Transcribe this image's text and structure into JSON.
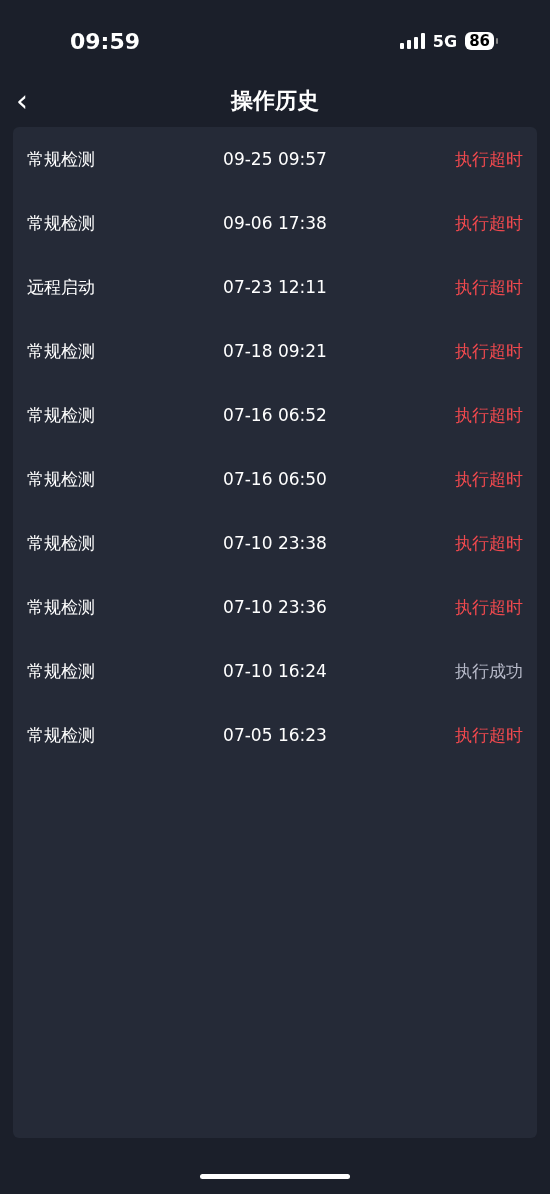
{
  "status_bar": {
    "time": "09:59",
    "network": "5G",
    "battery": "86"
  },
  "nav": {
    "back": "‹",
    "title": "操作历史"
  },
  "rows": [
    {
      "operation": "常规检测",
      "time": "09-25 09:57",
      "result": "执行超时",
      "kind": "timeout"
    },
    {
      "operation": "常规检测",
      "time": "09-06 17:38",
      "result": "执行超时",
      "kind": "timeout"
    },
    {
      "operation": "远程启动",
      "time": "07-23 12:11",
      "result": "执行超时",
      "kind": "timeout"
    },
    {
      "operation": "常规检测",
      "time": "07-18 09:21",
      "result": "执行超时",
      "kind": "timeout"
    },
    {
      "operation": "常规检测",
      "time": "07-16 06:52",
      "result": "执行超时",
      "kind": "timeout"
    },
    {
      "operation": "常规检测",
      "time": "07-16 06:50",
      "result": "执行超时",
      "kind": "timeout"
    },
    {
      "operation": "常规检测",
      "time": "07-10 23:38",
      "result": "执行超时",
      "kind": "timeout"
    },
    {
      "operation": "常规检测",
      "time": "07-10 23:36",
      "result": "执行超时",
      "kind": "timeout"
    },
    {
      "operation": "常规检测",
      "time": "07-10 16:24",
      "result": "执行成功",
      "kind": "success"
    },
    {
      "operation": "常规检测",
      "time": "07-05 16:23",
      "result": "执行超时",
      "kind": "timeout"
    }
  ]
}
